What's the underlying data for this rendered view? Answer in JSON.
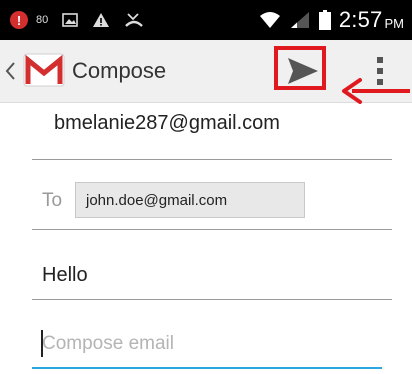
{
  "status_bar": {
    "signal_value": "80",
    "time": "2:57",
    "ampm": "PM",
    "icons": [
      "alert-icon",
      "image-icon",
      "warning-icon",
      "missed-call-icon",
      "wifi-icon",
      "cell-signal-icon",
      "battery-icon"
    ]
  },
  "action_bar": {
    "title": "Compose",
    "logo": "gmail-logo",
    "actions": [
      "send-icon",
      "overflow-menu-icon"
    ]
  },
  "compose": {
    "from": "bmelanie287@gmail.com",
    "to_label": "To",
    "to_recipient": "john.doe@gmail.com",
    "subject": "Hello",
    "body_placeholder": "Compose email"
  },
  "colors": {
    "status_bar_bg": "#000000",
    "action_bar_bg": "#f0f0f0",
    "highlight": "#e0191f",
    "focus_line": "#2aa6e0",
    "gmail_red": "#d32f2f"
  }
}
